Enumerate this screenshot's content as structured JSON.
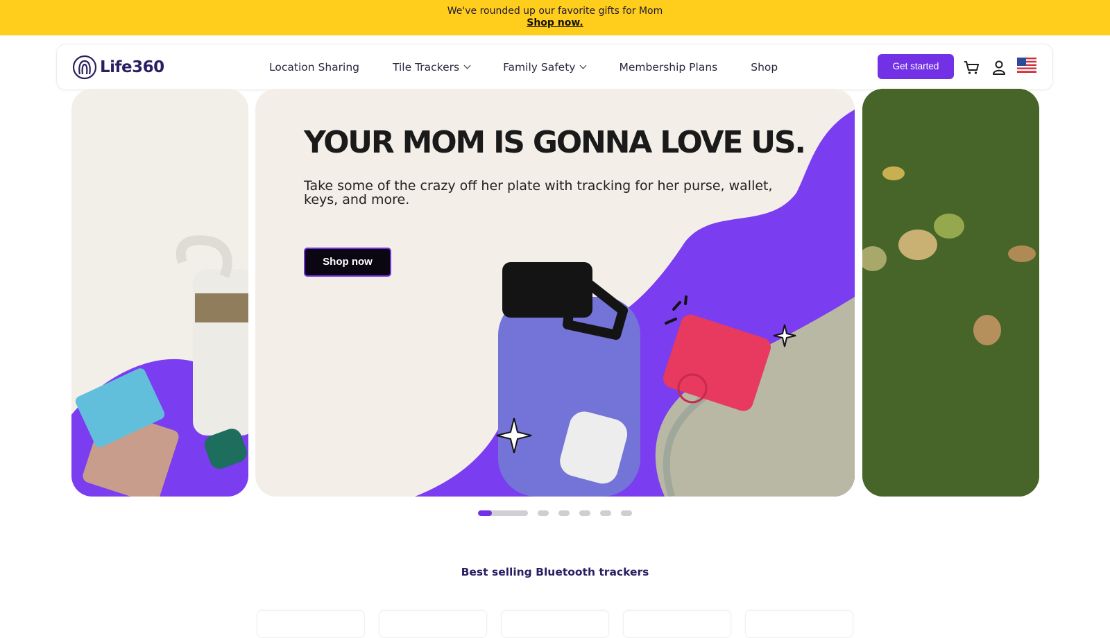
{
  "promo": {
    "message": "We've rounded up our favorite gifts for Mom",
    "link": "Shop now."
  },
  "header": {
    "logo_text": "Life360",
    "nav": [
      {
        "label": "Location Sharing",
        "dropdown": false
      },
      {
        "label": "Tile Trackers",
        "dropdown": true
      },
      {
        "label": "Family Safety",
        "dropdown": true
      },
      {
        "label": "Membership Plans",
        "dropdown": false
      },
      {
        "label": "Shop",
        "dropdown": false
      }
    ],
    "cta_label": "Get started",
    "icons": [
      "cart-icon",
      "user-icon",
      "us-flag-icon"
    ]
  },
  "hero": {
    "headline": "YOUR MOM IS GONNA LOVE US.",
    "subhead": "Take some of the crazy off her plate with tracking for her purse, wallet, keys, and more.",
    "button_label": "Shop now"
  },
  "carousel": {
    "slide_count": 6,
    "active_index": 0
  },
  "best_sellers": {
    "title": "Best selling Bluetooth trackers"
  },
  "colors": {
    "promo_bg": "#ffcd1c",
    "brand_purple": "#7331e6",
    "brand_navy": "#2a1f63"
  }
}
